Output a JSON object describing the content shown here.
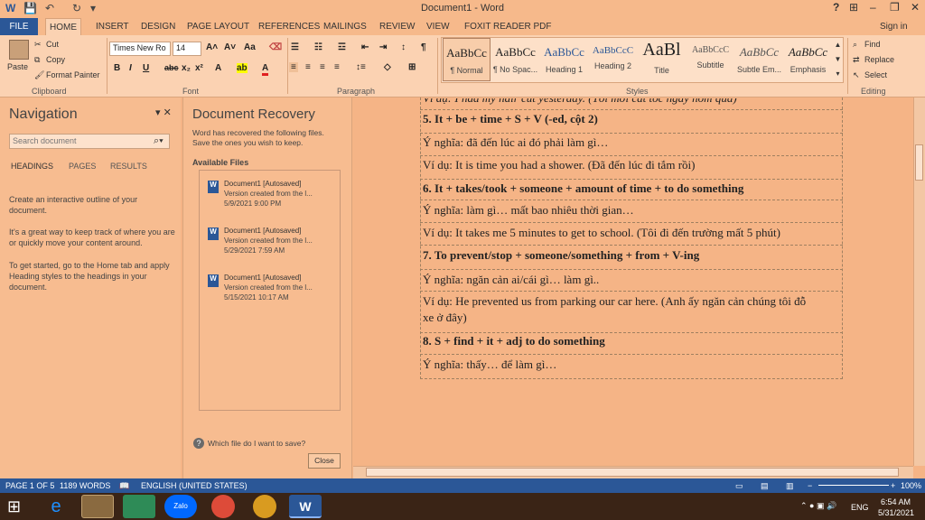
{
  "window": {
    "title": "Document1 - Word",
    "help": "?",
    "min": "–",
    "restore": "❐",
    "close": "✕",
    "opts": "⊞"
  },
  "quick_access": {
    "save": "💾",
    "undo": "↶",
    "redo": "↻",
    "more": "▾"
  },
  "tabs": [
    "FILE",
    "HOME",
    "INSERT",
    "DESIGN",
    "PAGE LAYOUT",
    "REFERENCES",
    "MAILINGS",
    "REVIEW",
    "VIEW",
    "FOXIT READER PDF"
  ],
  "signin": "Sign in",
  "clipboard": {
    "paste": "Paste",
    "cut": "Cut",
    "copy": "Copy",
    "format_painter": "Format Painter",
    "group": "Clipboard"
  },
  "font": {
    "name": "Times New Ro",
    "size": "14",
    "group": "Font"
  },
  "paragraph": {
    "group": "Paragraph"
  },
  "styles": {
    "group": "Styles",
    "items": [
      {
        "sample": "AaBbCc",
        "name": "¶ Normal"
      },
      {
        "sample": "AaBbCc",
        "name": "¶ No Spac..."
      },
      {
        "sample": "AaBbCc",
        "name": "Heading 1"
      },
      {
        "sample": "AaBbCcC",
        "name": "Heading 2"
      },
      {
        "sample": "AaBl",
        "name": "Title"
      },
      {
        "sample": "AaBbCcC",
        "name": "Subtitle"
      },
      {
        "sample": "AaBbCc",
        "name": "Subtle Em..."
      },
      {
        "sample": "AaBbCc",
        "name": "Emphasis"
      }
    ]
  },
  "editing": {
    "find": "Find",
    "replace": "Replace",
    "select": "Select",
    "group": "Editing"
  },
  "navigation": {
    "title": "Navigation",
    "search_placeholder": "Search document",
    "tabs": [
      "HEADINGS",
      "PAGES",
      "RESULTS"
    ],
    "p1": "Create an interactive outline of your document.",
    "p2": "It's a great way to keep track of where you are or quickly move your content around.",
    "p3": "To get started, go to the Home tab and apply Heading styles to the headings in your document."
  },
  "recovery": {
    "title": "Document Recovery",
    "desc": "Word has recovered the following files. Save the ones you wish to keep.",
    "available": "Available Files",
    "files": [
      {
        "name": "Document1  [Autosaved]",
        "version": "Version created from the l...",
        "date": "5/9/2021 9:00 PM"
      },
      {
        "name": "Document1  [Autosaved]",
        "version": "Version created from the l...",
        "date": "5/29/2021 7:59 AM"
      },
      {
        "name": "Document1  [Autosaved]",
        "version": "Version created from the l...",
        "date": "5/15/2021 10:17 AM"
      }
    ],
    "help": "Which file do I want to save?",
    "close": "Close"
  },
  "document": {
    "lines": [
      {
        "text": "Ví dụ: I had my hair cut yesterday. (Tôi mới cắt tóc ngày hôm qua)",
        "cls": "i"
      },
      {
        "text": "5. It + be + time + S + V (-ed, cột 2)",
        "cls": "b"
      },
      {
        "text": "Ý nghĩa: đã đến lúc ai đó phải làm gì…",
        "cls": ""
      },
      {
        "text": "Ví dụ: It is time you had a shower. (Đã đến lúc đi tắm rồi)",
        "cls": ""
      },
      {
        "text": "6. It + takes/took + someone + amount of time + to do something",
        "cls": "b"
      },
      {
        "text": "Ý nghĩa: làm gì… mất bao nhiêu thời gian…",
        "cls": ""
      },
      {
        "text": "Ví dụ: It takes me 5 minutes to get to school. (Tôi đi đến trường mất 5 phút)",
        "cls": ""
      },
      {
        "text": "7. To prevent/stop + someone/something + from + V-ing",
        "cls": "b"
      },
      {
        "text": "Ý nghĩa: ngăn cản ai/cái gì… làm gì..",
        "cls": ""
      },
      {
        "text": "Ví dụ: He prevented us from parking our car here. (Anh ấy ngăn cản chúng tôi đỗ",
        "cls": ""
      },
      {
        "text": "xe ở đây)",
        "cls": ""
      },
      {
        "text": "8.  S + find + it + adj to do something",
        "cls": "b"
      },
      {
        "text": "Ý nghĩa: thấy… để làm gì…",
        "cls": ""
      }
    ]
  },
  "status": {
    "page": "PAGE 1 OF 5",
    "words": "1189 WORDS",
    "lang": "ENGLISH (UNITED STATES)",
    "zoom": "100%"
  },
  "taskbar": {
    "lang": "ENG",
    "time": "6:54 AM",
    "date": "5/31/2021"
  }
}
